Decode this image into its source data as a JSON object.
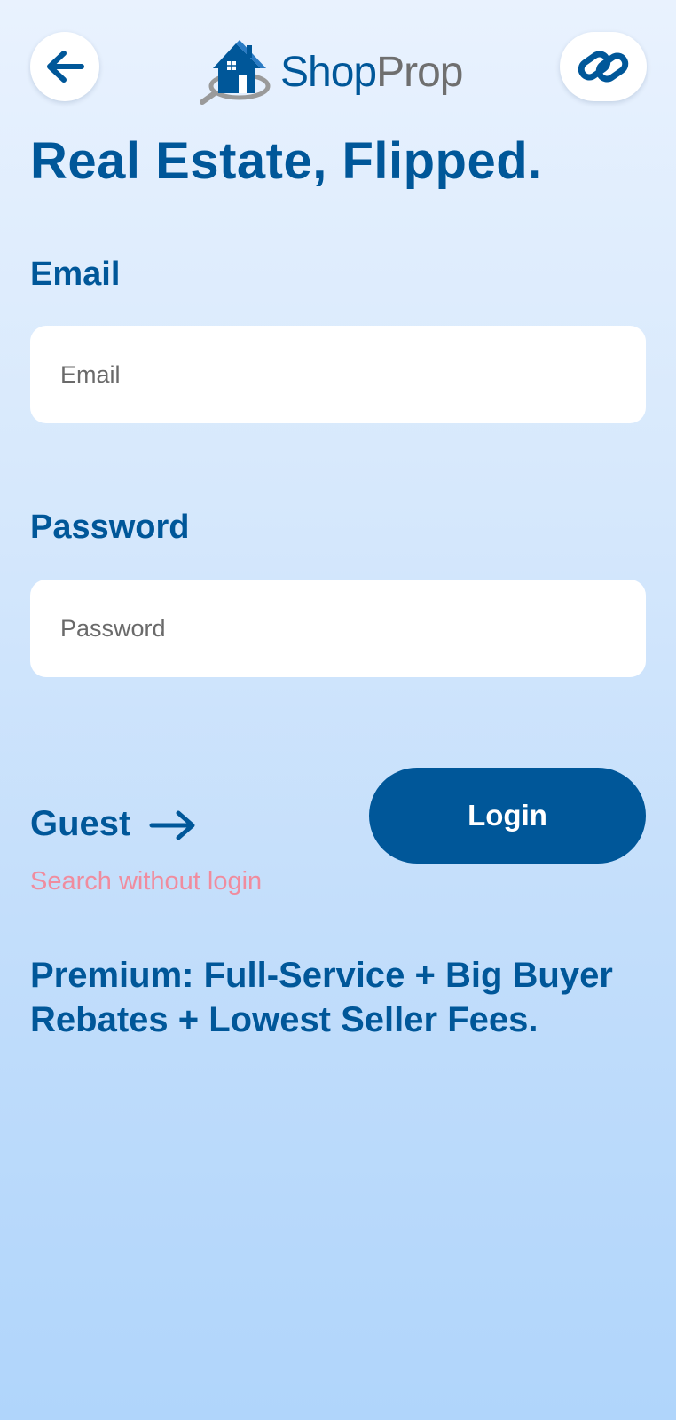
{
  "header": {
    "back_icon": "arrow-left-icon",
    "link_icon": "link-icon",
    "logo": {
      "icon": "house-magnifier-icon",
      "text_part1": "Shop",
      "text_part2": "Prop",
      "colors": {
        "primary": "#005799",
        "secondary": "#6f6f6f"
      }
    }
  },
  "headline": "Real Estate, Flipped.",
  "form": {
    "email": {
      "label": "Email",
      "placeholder": "Email",
      "value": ""
    },
    "password": {
      "label": "Password",
      "placeholder": "Password",
      "value": ""
    }
  },
  "guest": {
    "label": "Guest",
    "arrow_icon": "arrow-right-icon",
    "subtitle": "Search without login"
  },
  "login_button": {
    "label": "Login"
  },
  "premium_text": "Premium: Full-Service + Big Buyer Rebates + Lowest Seller Fees.",
  "colors": {
    "brand": "#005799",
    "accent_pink": "#f08c9e",
    "background_top": "#e9f2fe",
    "background_bottom": "#b0d5fb",
    "field_bg": "#ffffff"
  }
}
